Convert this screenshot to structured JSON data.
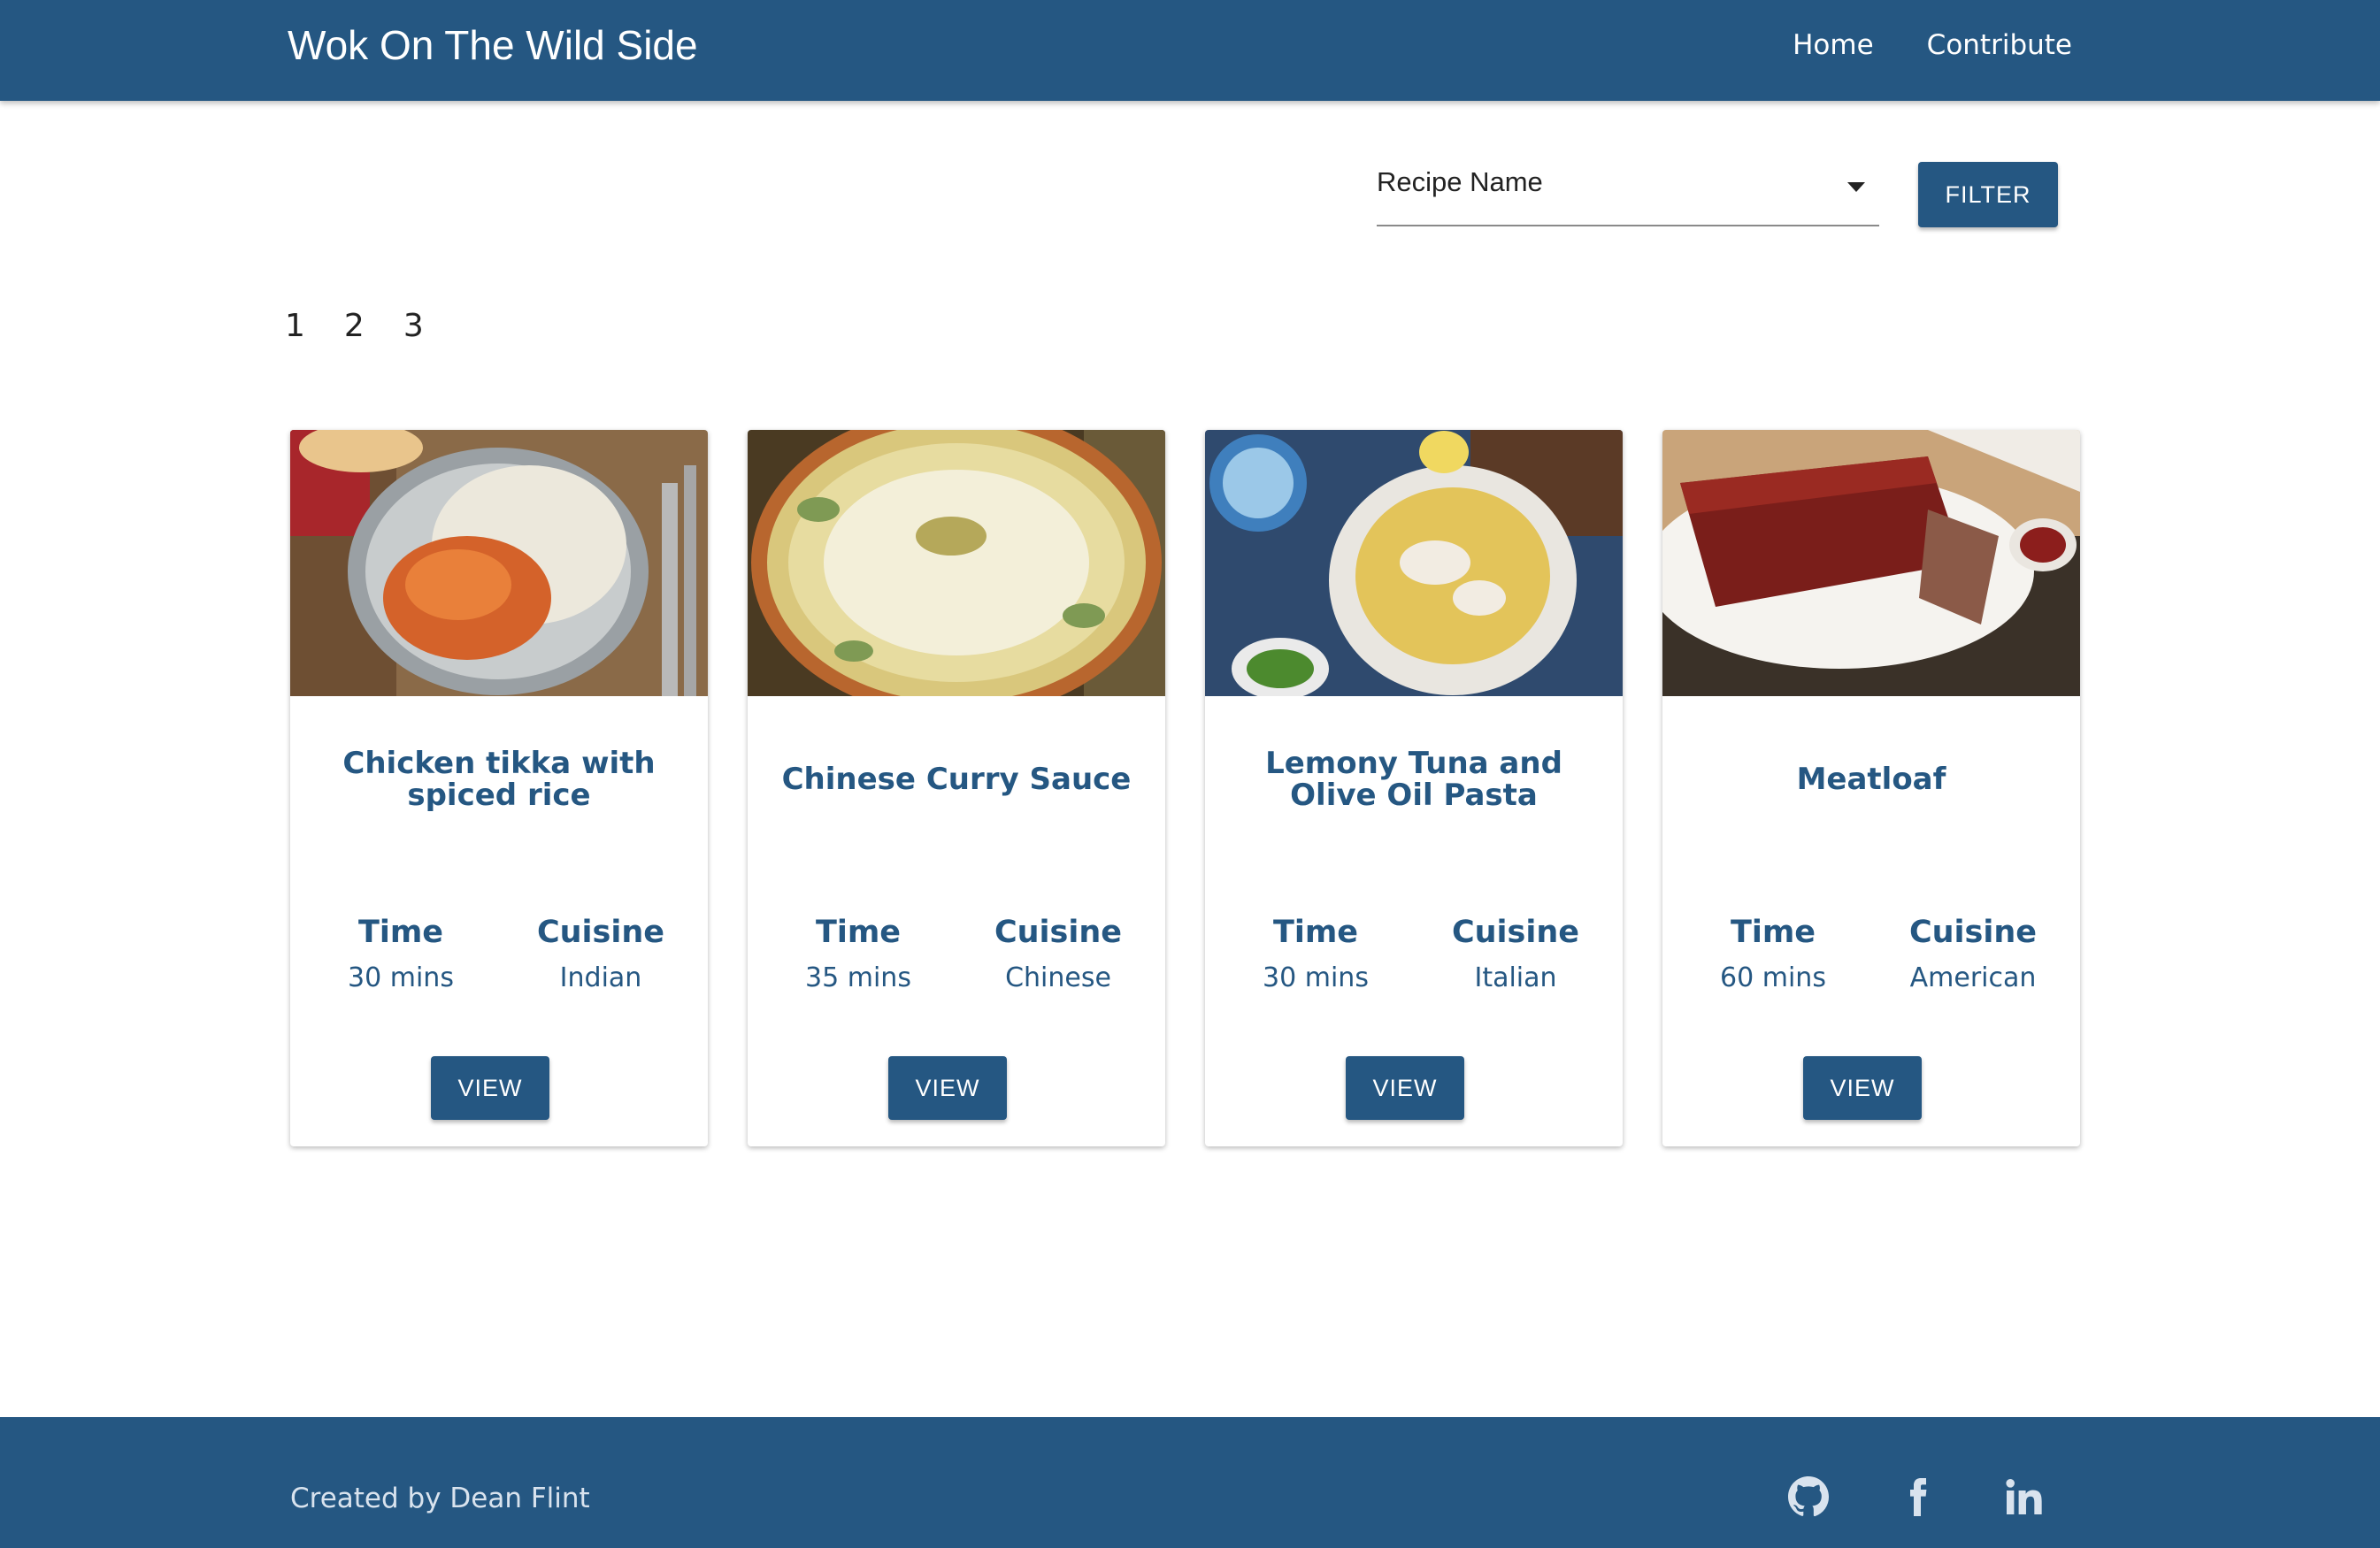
{
  "header": {
    "title": "Wok On The Wild Side",
    "nav": [
      {
        "label": "Home"
      },
      {
        "label": "Contribute"
      }
    ]
  },
  "filter": {
    "selected": "Recipe Name",
    "button_label": "FILTER"
  },
  "pagination": [
    "1",
    "2",
    "3"
  ],
  "recipes": [
    {
      "title": "Chicken tikka with spiced rice",
      "time_label": "Time",
      "time": "30 mins",
      "cuisine_label": "Cuisine",
      "cuisine": "Indian",
      "button": "VIEW",
      "image": "chicken-tikka-photo"
    },
    {
      "title": "Chinese Curry Sauce",
      "time_label": "Time",
      "time": "35 mins",
      "cuisine_label": "Cuisine",
      "cuisine": "Chinese",
      "button": "VIEW",
      "image": "curry-rice-photo"
    },
    {
      "title": "Lemony Tuna and Olive Oil Pasta",
      "time_label": "Time",
      "time": "30 mins",
      "cuisine_label": "Cuisine",
      "cuisine": "Italian",
      "button": "VIEW",
      "image": "tuna-pasta-photo"
    },
    {
      "title": "Meatloaf",
      "time_label": "Time",
      "time": "60 mins",
      "cuisine_label": "Cuisine",
      "cuisine": "American",
      "button": "VIEW",
      "image": "meatloaf-photo"
    }
  ],
  "footer": {
    "credit": "Created by Dean Flint",
    "social": [
      "github-icon",
      "facebook-icon",
      "linkedin-icon"
    ]
  },
  "colors": {
    "primary": "#255782",
    "background": "#ffffff"
  }
}
